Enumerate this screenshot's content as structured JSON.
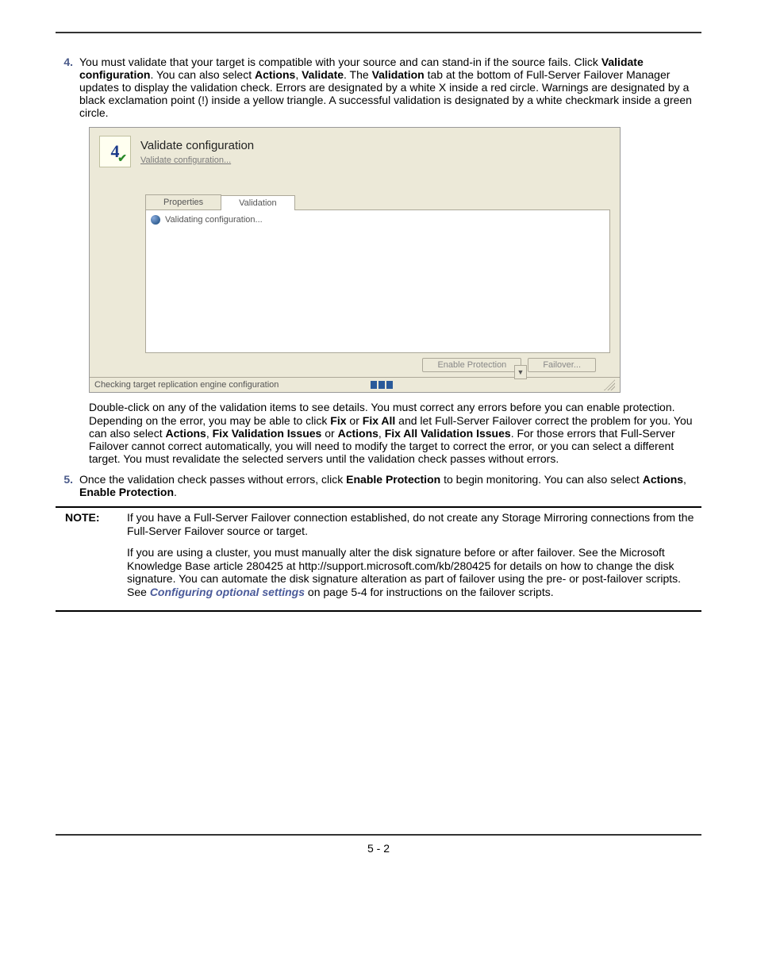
{
  "steps": {
    "s4": {
      "num": "4.",
      "text_parts": [
        "You must validate that your target is compatible with your source and can stand-in if the source fails. Click ",
        "Validate configuration",
        ". You can also select ",
        "Actions",
        ", ",
        "Validate",
        ". The ",
        "Validation",
        " tab at the bottom of Full-Server Failover Manager updates to display the validation check. Errors are designated by a white X inside a red circle. Warnings are designated by a black exclamation point (!) inside a yellow triangle. A successful validation is designated by a white checkmark inside a green circle."
      ]
    },
    "s4_after": {
      "parts": [
        "Double-click on any of the validation items to see details. You must correct any errors before you can enable protection. Depending on the error, you may be able to click ",
        "Fix",
        " or ",
        "Fix All",
        " and let Full-Server Failover correct the problem for you. You can also select ",
        "Actions",
        ", ",
        "Fix Validation Issues",
        " or ",
        "Actions",
        ", ",
        "Fix All Validation Issues",
        ". For those errors that Full-Server Failover cannot correct automatically, you will need to modify the target to correct the error, or you can select a different target. You must revalidate the selected servers until the validation check passes without errors."
      ]
    },
    "s5": {
      "num": "5.",
      "parts": [
        "Once the validation check passes without errors, click ",
        "Enable Protection",
        " to begin monitoring. You can also select ",
        "Actions",
        ", ",
        "Enable Protection",
        "."
      ]
    }
  },
  "screenshot": {
    "icon_num": "4",
    "title": "Validate configuration",
    "link": "Validate configuration...",
    "tabs": {
      "properties": "Properties",
      "validation": "Validation"
    },
    "row_text": "Validating configuration...",
    "btn_enable": "Enable Protection",
    "btn_failover": "Failover...",
    "status": "Checking target replication engine configuration"
  },
  "note": {
    "label": "NOTE:",
    "p1": "If you have a Full-Server Failover connection established, do not create any Storage Mirroring connections from the Full-Server Failover source or target.",
    "p2_parts": [
      "If you are using a cluster, you must manually alter the disk signature before or after failover. See the Microsoft Knowledge Base article 280425 at http://support.microsoft.com/kb/280425 for details on how to change the disk signature. You can automate the disk signature alteration as part of failover using the pre- or post-failover scripts. See ",
      "Configuring optional settings",
      " on page 5-4 for instructions on the failover scripts."
    ]
  },
  "footer": "5 - 2"
}
